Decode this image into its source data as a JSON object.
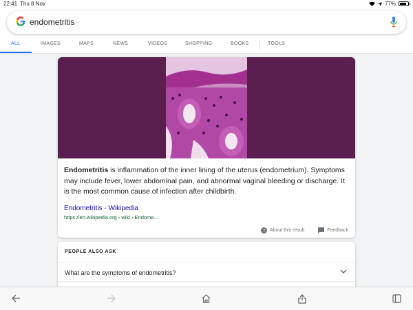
{
  "status_bar": {
    "time": "22:41",
    "date": "Thu 8 Nov",
    "battery": "77%"
  },
  "search": {
    "query": "endometritis",
    "logo": "G",
    "tabs": [
      {
        "label": "ALL",
        "active": true
      },
      {
        "label": "IMAGES"
      },
      {
        "label": "MAPS"
      },
      {
        "label": "NEWS"
      },
      {
        "label": "VIDEOS"
      },
      {
        "label": "SHOPPING"
      },
      {
        "label": "BOOKS"
      },
      {
        "label": "TOOLS"
      }
    ]
  },
  "result": {
    "term": "Endometritis",
    "description": " is inflammation of the inner lining of the uterus (endometrium). Symptoms may include fever, lower abdominal pain, and abnormal vaginal bleeding or discharge. It is the most common cause of infection after childbirth.",
    "source_title": "Endometritis - Wikipedia",
    "source_url": "https://en.wikipedia.org › wiki › Endome...",
    "about_label": "About this result",
    "feedback_label": "Feedback",
    "colors": {
      "hero_bg": "#5a1f4e",
      "stain": "#b0399f"
    }
  },
  "people_also_ask": {
    "title": "PEOPLE ALSO ASK",
    "questions": [
      "What are the symptoms of endometritis?"
    ]
  },
  "toolbar": {
    "icons": [
      "back-arrow-icon",
      "forward-arrow-icon",
      "home-icon",
      "share-icon",
      "tabs-icon"
    ]
  }
}
